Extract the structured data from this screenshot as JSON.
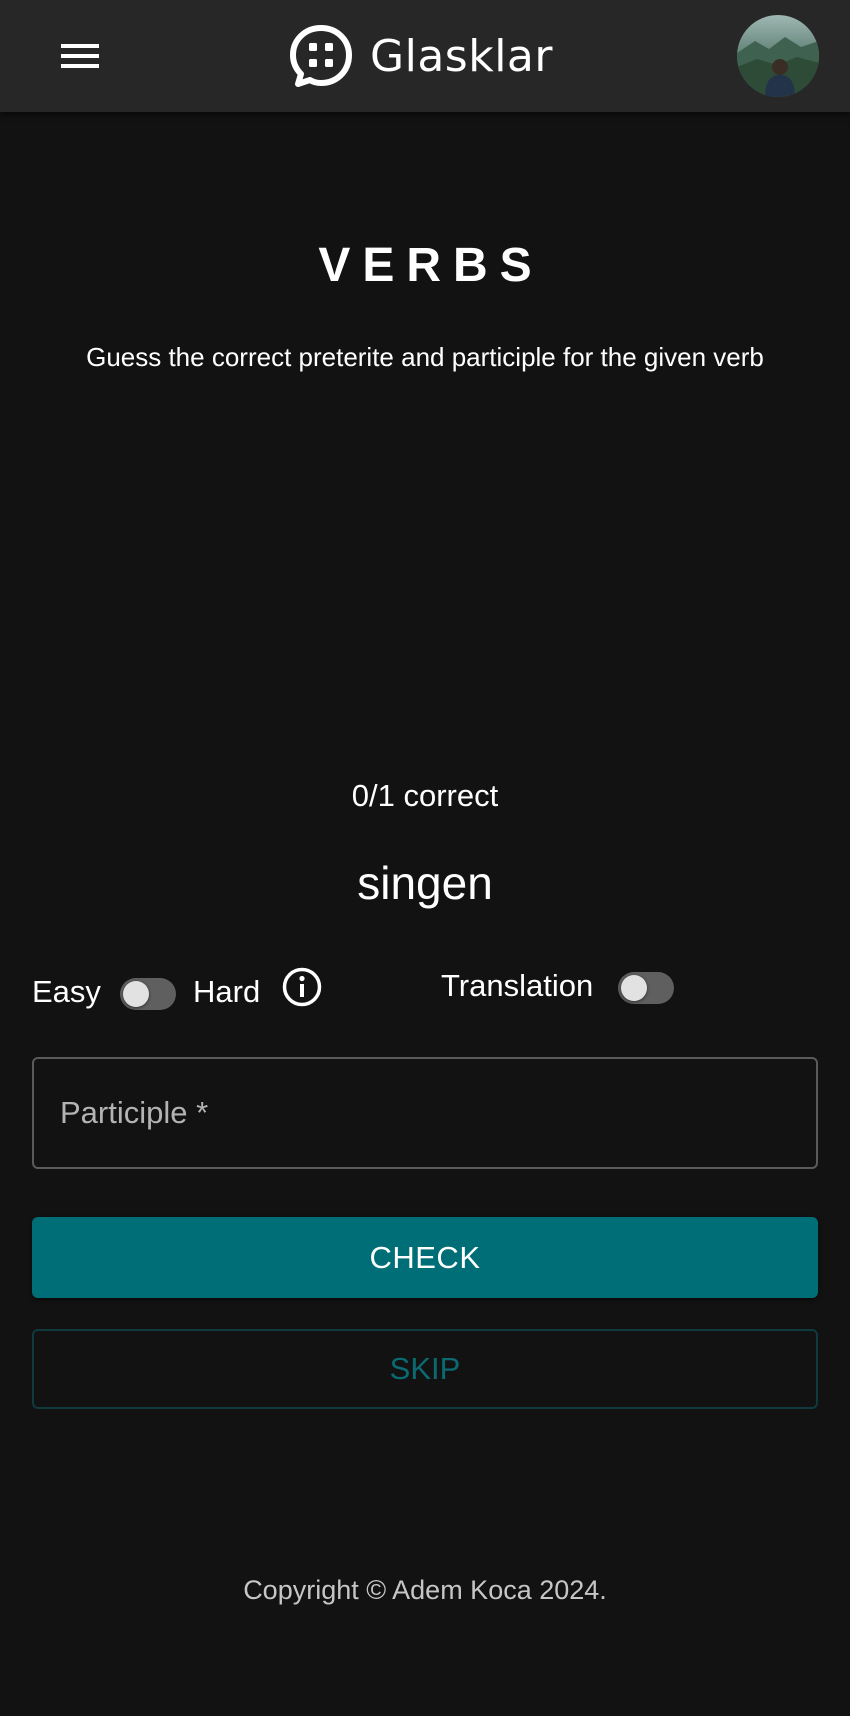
{
  "header": {
    "brand": "Glasklar",
    "menu_icon": "hamburger-menu-icon",
    "logo_icon": "chat-bubble-grid-icon",
    "avatar": "user-avatar"
  },
  "main": {
    "title": "VERBS",
    "subtitle": "Guess the correct preterite and participle for the given verb",
    "score": "0/1 correct",
    "verb": "singen"
  },
  "options": {
    "easy_label": "Easy",
    "hard_label": "Hard",
    "difficulty_hard_enabled": false,
    "info_icon": "info-circle-icon",
    "translation_label": "Translation",
    "translation_enabled": false
  },
  "form": {
    "participle_placeholder": "Participle *",
    "participle_value": "",
    "check_label": "CHECK",
    "skip_label": "SKIP"
  },
  "footer": {
    "copyright": "Copyright © Adem Koca 2024."
  },
  "colors": {
    "background": "#121212",
    "appbar": "#272727",
    "accent": "#006e76",
    "skip_text": "#0a6a72"
  }
}
